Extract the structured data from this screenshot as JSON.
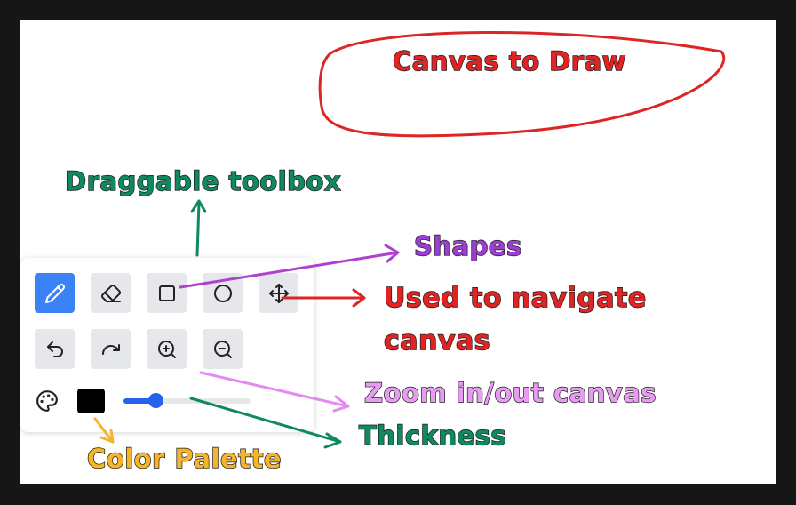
{
  "annotations": {
    "canvas_label": "Canvas to Draw",
    "toolbox_label": "Draggable toolbox",
    "shapes_label": "Shapes",
    "navigate_label_line1": "Used to navigate",
    "navigate_label_line2": "canvas",
    "zoom_label": "Zoom in/out canvas",
    "thickness_label": "Thickness",
    "palette_label": "Color Palette"
  },
  "colors": {
    "active_tool": "#3b82f6",
    "selected_color": "#000000",
    "canvas_label": "#e02424",
    "toolbox_label": "#0f8a5f",
    "shapes_label": "#9b3fd1",
    "navigate_label": "#e02424",
    "zoom_label": "#e79cf2",
    "thickness_label": "#0f8a5f",
    "palette_label": "#f4b42b"
  },
  "toolbox": {
    "tools_row1": [
      "pencil-icon",
      "eraser-icon",
      "square-icon",
      "circle-icon",
      "move-icon"
    ],
    "tools_row2": [
      "undo-icon",
      "redo-icon",
      "zoom-in-icon",
      "zoom-out-icon"
    ],
    "active_tool": "pencil",
    "thickness": 0.25
  }
}
